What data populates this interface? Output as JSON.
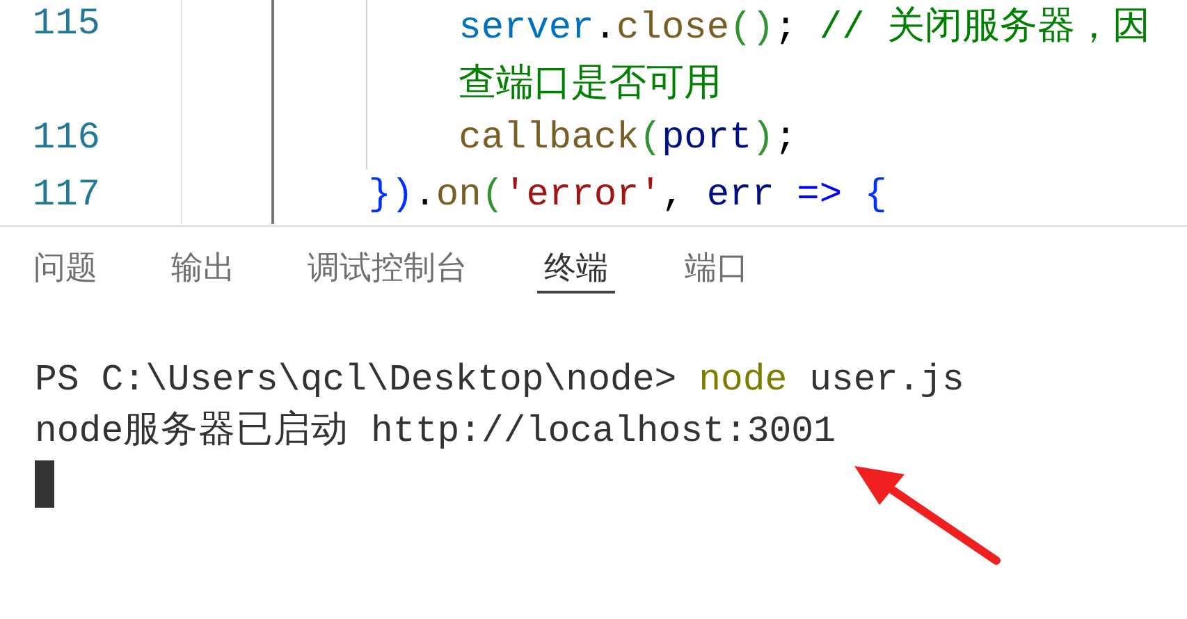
{
  "editor": {
    "lines": [
      {
        "number": "115",
        "tokens": [
          {
            "text": "        server",
            "kind": "variable"
          },
          {
            "text": ".",
            "kind": "punct"
          },
          {
            "text": "close",
            "kind": "function"
          },
          {
            "text": "()",
            "kind": "bracket"
          },
          {
            "text": "; ",
            "kind": "punct"
          },
          {
            "text": "// 关闭服务器，因",
            "kind": "comment"
          }
        ]
      },
      {
        "tokens": [
          {
            "text": "        查端口是否可用",
            "kind": "comment"
          }
        ]
      },
      {
        "number": "116",
        "tokens": [
          {
            "text": "        callback",
            "kind": "function"
          },
          {
            "text": "(",
            "kind": "bracket"
          },
          {
            "text": "port",
            "kind": "param"
          },
          {
            "text": ")",
            "kind": "bracket"
          },
          {
            "text": ";",
            "kind": "punct"
          }
        ]
      },
      {
        "number": "117",
        "tokens": [
          {
            "text": "    })",
            "kind": "brace"
          },
          {
            "text": ".",
            "kind": "punct"
          },
          {
            "text": "on",
            "kind": "function"
          },
          {
            "text": "(",
            "kind": "bracket"
          },
          {
            "text": "'error'",
            "kind": "string"
          },
          {
            "text": ", ",
            "kind": "punct"
          },
          {
            "text": "err ",
            "kind": "param"
          },
          {
            "text": "=> ",
            "kind": "keyword"
          },
          {
            "text": "{",
            "kind": "brace"
          }
        ]
      }
    ]
  },
  "panel": {
    "tabs": [
      {
        "label": "问题",
        "selected": false
      },
      {
        "label": "输出",
        "selected": false
      },
      {
        "label": "调试控制台",
        "selected": false
      },
      {
        "label": "终端",
        "selected": true
      },
      {
        "label": "端口",
        "selected": false
      }
    ]
  },
  "terminal": {
    "lines": [
      {
        "tokens": [
          {
            "text": "PS C:\\Users\\qcl\\Desktop\\node> ",
            "kind": "plain"
          },
          {
            "text": "node",
            "kind": "command"
          },
          {
            "text": " user.js",
            "kind": "plain"
          }
        ]
      },
      {
        "tokens": [
          {
            "text": "node服务器已启动 http://localhost:3001",
            "kind": "plain"
          }
        ]
      }
    ]
  }
}
